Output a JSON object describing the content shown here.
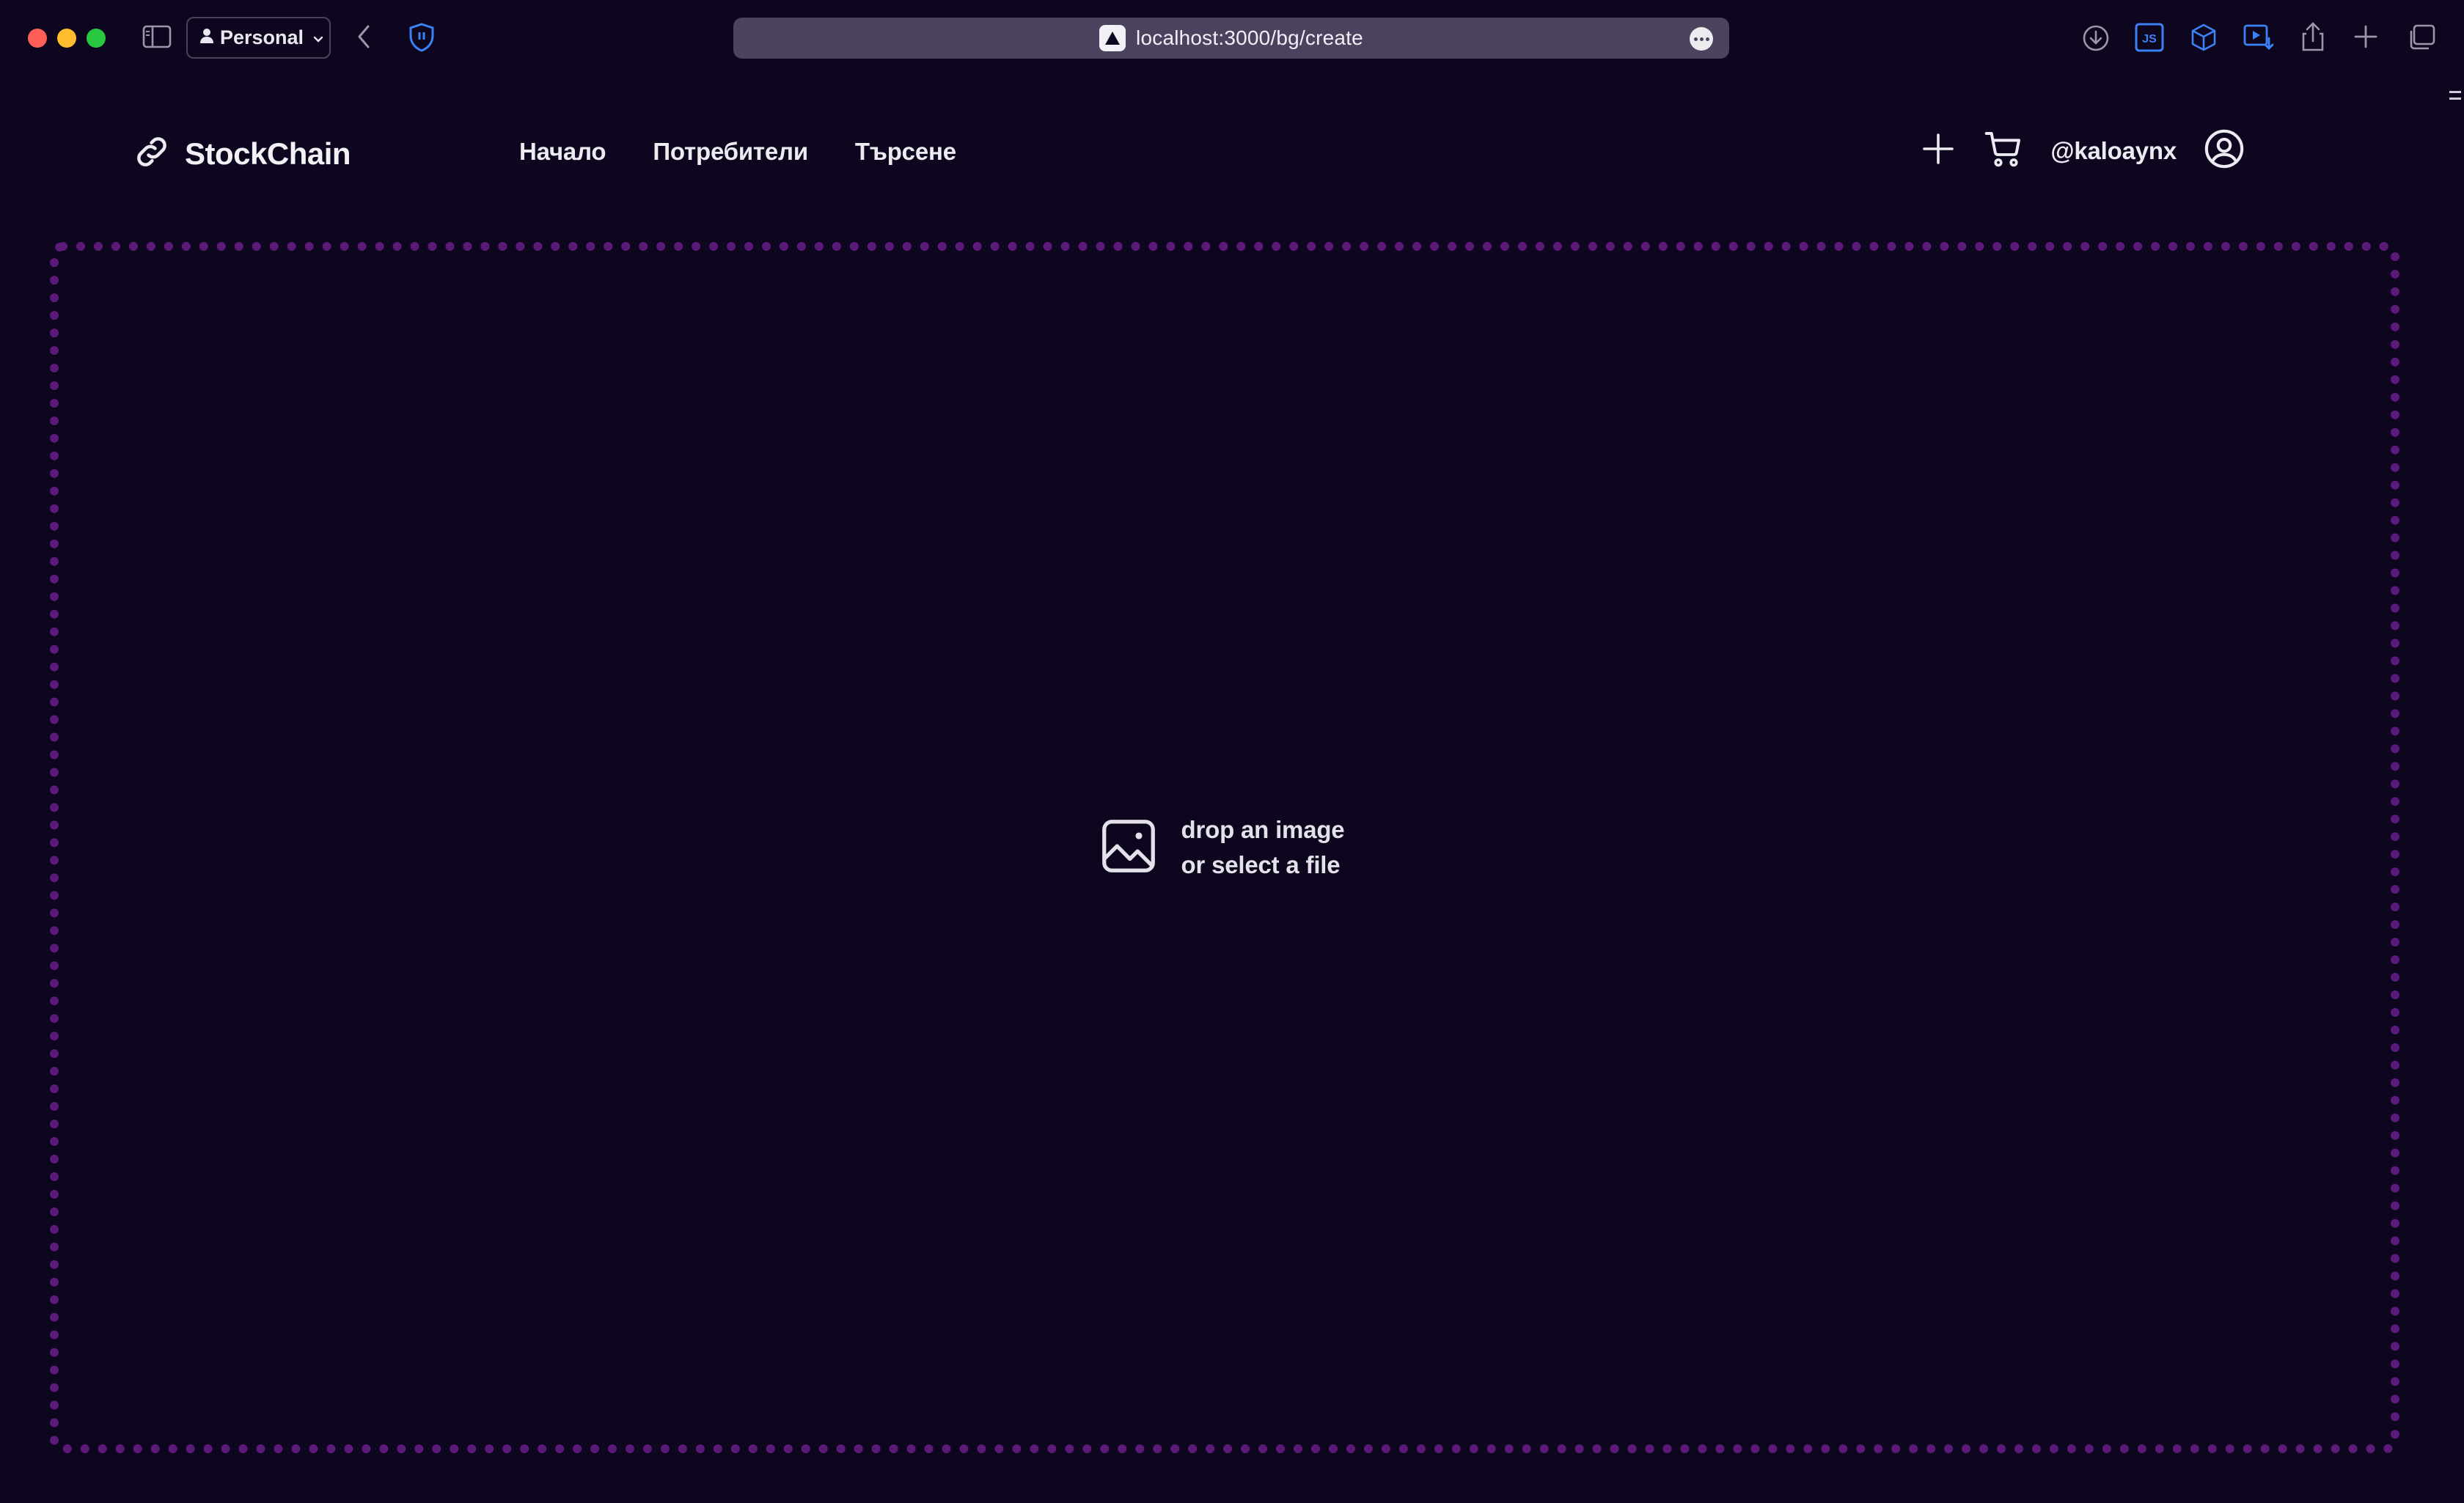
{
  "browser": {
    "profile_label": "Personal",
    "url": "localhost:3000/bg/create",
    "traffic_colors": {
      "close": "#ff5f57",
      "minimize": "#febc2e",
      "zoom": "#28c840"
    }
  },
  "site": {
    "brand": "StockChain",
    "nav": [
      {
        "label": "Начало"
      },
      {
        "label": "Потребители"
      },
      {
        "label": "Търсене"
      }
    ],
    "username": "@kaloaynx"
  },
  "dropzone": {
    "line1": "drop an image",
    "line2": "or select a file",
    "border_color": "#5b1a7a"
  },
  "theme": {
    "background": "#0e061e",
    "accent_blue": "#3b82f6"
  }
}
